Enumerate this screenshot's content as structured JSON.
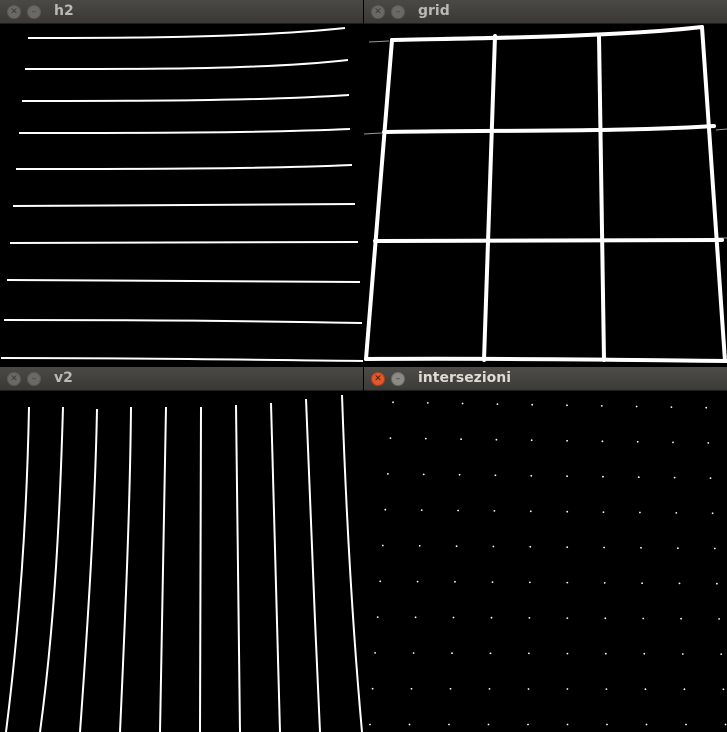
{
  "windows": {
    "h2": {
      "title": "h2",
      "active": false,
      "content": "horizontal-lines"
    },
    "grid": {
      "title": "grid",
      "active": false,
      "content": "grid-lines"
    },
    "v2": {
      "title": "v2",
      "active": false,
      "content": "vertical-lines"
    },
    "intersezioni": {
      "title": "intersezioni",
      "active": true,
      "content": "intersection-points"
    }
  },
  "icons": {
    "close": "close-icon",
    "minimize": "minimize-icon"
  },
  "colors": {
    "titlebar": "#3c3b37",
    "title_text_inactive": "#bab9b4",
    "title_text_active": "#dfdbd2",
    "close_active": "#e2572b",
    "image_background": "#000000",
    "line_color": "#ffffff"
  }
}
